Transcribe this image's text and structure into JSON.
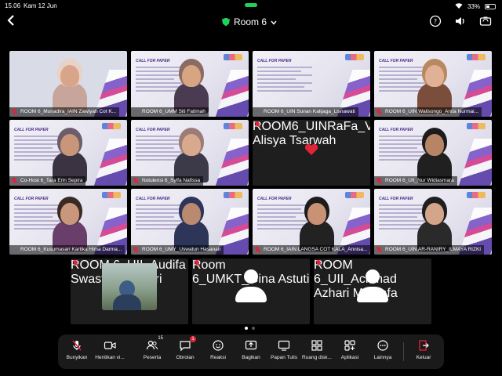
{
  "status_bar": {
    "time": "15.06",
    "date": "Kam 12 Jun",
    "battery": "33%"
  },
  "header": {
    "room_title": "Room 6"
  },
  "tiles": [
    {
      "label": "ROOM 6_Munadira_IAIN Zawiyah Cot K...",
      "muted": true,
      "poster": false,
      "skin": "#d9a58a",
      "hijab": "#e8d2c8",
      "shirt": "#c8a59a"
    },
    {
      "label": "ROOM 6_UMM Siti Fatimah",
      "muted": false,
      "poster": true,
      "skin": "#d7a582",
      "hijab": "#8c6b64",
      "shirt": "#4a3a52"
    },
    {
      "label": "ROOM 6_UIN Sunan Kalijaga_Lisnawati",
      "muted": false,
      "poster": true
    },
    {
      "label": "ROOM 6_UIN Walisongo_Anita Nurmai...",
      "muted": true,
      "poster": true,
      "skin": "#e0b194",
      "hijab": "#b8895e",
      "shirt": "#7a4e3a"
    },
    {
      "label": "Co-Host 6_Tara Erin Sepira",
      "muted": true,
      "poster": true,
      "skin": "#c9967a",
      "hijab": "#6b5d6a",
      "shirt": "#3b3242"
    },
    {
      "label": "Notulensi 6_Syifa Nafissa",
      "muted": true,
      "poster": true,
      "skin": "#d8a98d",
      "hijab": "#9c7c78",
      "shirt": "#3c3a48"
    },
    {
      "label": "ROOM6_UINRaFa_Veny Alisya Tsarwah",
      "muted": true,
      "poster": false,
      "dark": true
    },
    {
      "label": "ROOM 6_UII_Nur Widiasmara",
      "muted": true,
      "poster": true,
      "skin": "#b88466",
      "hijab": "#1c1c1c",
      "shirt": "#202020"
    },
    {
      "label": "ROOM 6_Kusumasari Kartika Hima Darma...",
      "muted": false,
      "poster": true,
      "skin": "#c9987c",
      "hijab": "#3a2a24",
      "shirt": "#6a3e6a"
    },
    {
      "label": "ROOM 6_UMY_Uswatun Hasanah",
      "muted": true,
      "poster": true,
      "skin": "#b98a6f",
      "hijab": "#2d3558",
      "shirt": "#2d3558"
    },
    {
      "label": "ROOM 6_IAIN LANGSA COT KALA_Annisa...",
      "muted": true,
      "poster": true,
      "skin": "#c99275",
      "hijab": "#1c1c1c",
      "shirt": "#222"
    },
    {
      "label": "ROOM 6_UIN AR-RANIRY_ILMAYA RIZKI",
      "muted": true,
      "poster": true,
      "skin": "#d4a58a",
      "hijab": "#1f1f1f",
      "shirt": "#2a2a2a"
    }
  ],
  "bottom_tiles": [
    {
      "label": "ROOM 6_UII_Audifa Swastriana Putri",
      "has_photo": true
    },
    {
      "label": "Room 6_UMKT_Gina Astuti",
      "has_photo": false
    },
    {
      "label": "ROOM 6_UII_Achmad Azhari Mustafa",
      "has_photo": false
    }
  ],
  "toolbar": {
    "mute": "Bunyikan",
    "video": "Hentikan vi...",
    "participants": "Peserta",
    "participants_count": "15",
    "chat": "Obrolan",
    "chat_badge": "1",
    "reactions": "Reaksi",
    "share": "Bagikan",
    "whiteboard": "Papan Tulis",
    "breakout": "Ruang disk...",
    "apps": "Aplikasi",
    "more": "Lainnya",
    "leave": "Keluar"
  },
  "poster_heading": "CALL FOR PAPER",
  "colors": {
    "accent_green": "#1fd35a",
    "muted_red": "#e0243a",
    "leave_red": "#e0243a"
  }
}
